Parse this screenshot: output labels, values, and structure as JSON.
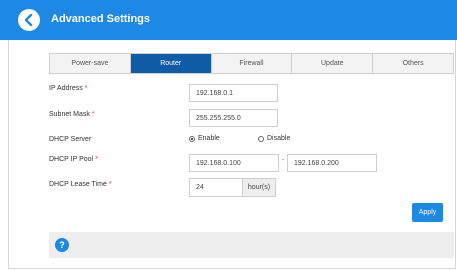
{
  "header": {
    "title": "Advanced Settings",
    "back_icon": "chevron-left-icon"
  },
  "tabs": [
    {
      "label": "Power-save",
      "active": false
    },
    {
      "label": "Router",
      "active": true
    },
    {
      "label": "Firewall",
      "active": false
    },
    {
      "label": "Update",
      "active": false
    },
    {
      "label": "Others",
      "active": false
    }
  ],
  "form": {
    "ip_address": {
      "label": "IP Address",
      "required": "*",
      "value": "192.168.0.1"
    },
    "subnet_mask": {
      "label": "Subnet Mask",
      "required": "*",
      "value": "255.255.255.0"
    },
    "dhcp_server": {
      "label": "DHCP Server",
      "enable_label": "Enable",
      "disable_label": "Disable",
      "selected": "Enable"
    },
    "dhcp_ip_pool": {
      "label": "DHCP IP Pool",
      "required": "*",
      "start": "192.168.0.100",
      "separator": "-",
      "end": "192.168.0.200"
    },
    "dhcp_lease_time": {
      "label": "DHCP Lease Time",
      "required": "*",
      "value": "24",
      "unit": "hour(s)"
    }
  },
  "apply_label": "Apply",
  "help": {
    "glyph": "?",
    "icon": "help-icon"
  },
  "colors": {
    "accent": "#1e88e5",
    "active_tab": "#0e5ca5",
    "required": "#e53935"
  }
}
